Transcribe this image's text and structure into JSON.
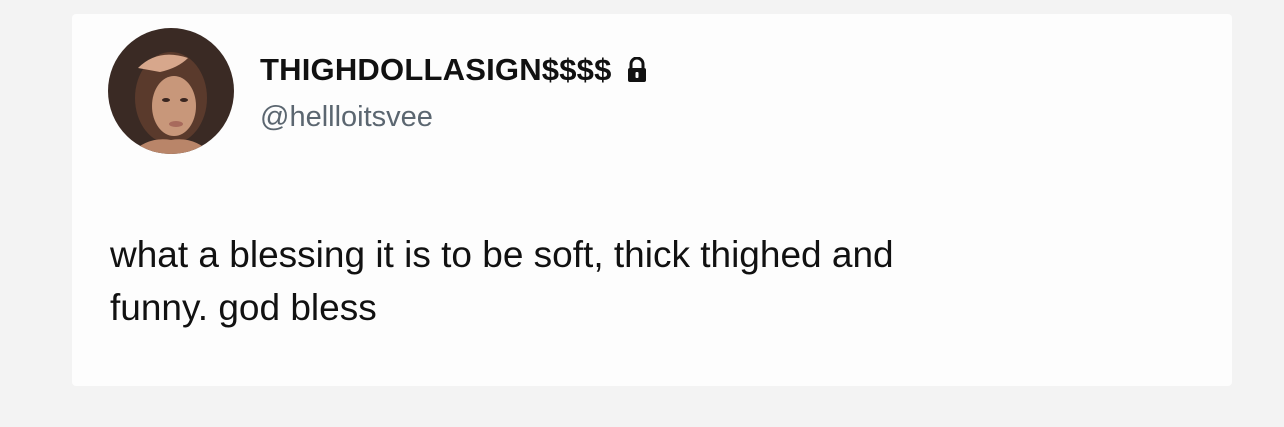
{
  "tweet": {
    "display_name": "THIGHDOLLASIGN$$$$",
    "handle": "@hellloitsvee",
    "protected_icon": "lock-icon",
    "avatar_icon": "profile-photo",
    "text_line_1": "what a blessing it is to be soft, thick thighed and",
    "text_line_2": "funny. god bless"
  },
  "colors": {
    "background": "#f3f3f3",
    "card": "#fdfdfd",
    "text": "#111111",
    "handle": "#5b6670"
  }
}
